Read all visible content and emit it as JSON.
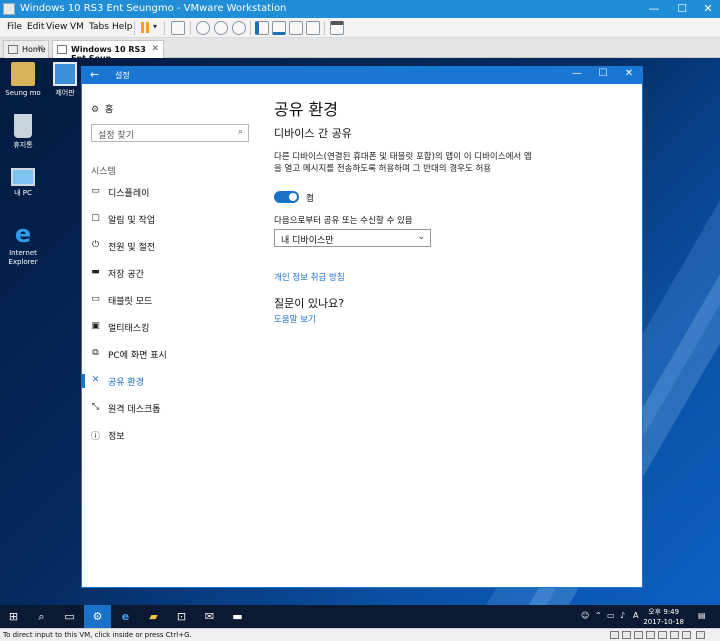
{
  "vmware": {
    "title": "Windows 10 RS3 Ent Seungmo - VMware Workstation",
    "menu": [
      "File",
      "Edit",
      "View",
      "VM",
      "Tabs",
      "Help"
    ],
    "tabs": [
      {
        "label": "Home",
        "active": false
      },
      {
        "label": "Windows 10 RS3 Ent Seun...",
        "active": true
      }
    ],
    "status_text": "To direct input to this VM, click inside or press Ctrl+G."
  },
  "desktop": {
    "icons": [
      {
        "label": "Seung mo",
        "icon": "user-folder-icon"
      },
      {
        "label": "제어판",
        "icon": "control-panel-icon"
      },
      {
        "label": "휴지통",
        "icon": "recycle-bin-icon"
      },
      {
        "label": "내 PC",
        "icon": "computer-icon"
      },
      {
        "label": "Internet Explorer",
        "icon": "ie-icon"
      }
    ]
  },
  "settings": {
    "window_title": "설정",
    "home_label": "홈",
    "search_placeholder": "설정 찾기",
    "section_label": "시스템",
    "nav": [
      {
        "label": "디스플레이",
        "icon": "display-icon",
        "active": false
      },
      {
        "label": "알림 및 작업",
        "icon": "notifications-icon",
        "active": false
      },
      {
        "label": "전원 및 절전",
        "icon": "power-icon",
        "active": false
      },
      {
        "label": "저장 공간",
        "icon": "storage-icon",
        "active": false
      },
      {
        "label": "태블릿 모드",
        "icon": "tablet-icon",
        "active": false
      },
      {
        "label": "멀티태스킹",
        "icon": "multitasking-icon",
        "active": false
      },
      {
        "label": "PC에 화면 표시",
        "icon": "project-icon",
        "active": false
      },
      {
        "label": "공유 환경",
        "icon": "shared-experiences-icon",
        "active": true
      },
      {
        "label": "원격 데스크톱",
        "icon": "remote-desktop-icon",
        "active": false
      },
      {
        "label": "정보",
        "icon": "info-icon",
        "active": false
      }
    ],
    "page_title": "공유 환경",
    "subheading": "디바이스 간 공유",
    "description": "다른 디바이스(연결된 휴대폰 및 태블릿 포함)의 앱이 이 디바이스에서 앱을 열고 메시지를 전송하도록 허용하며 그 반대의 경우도 허용",
    "toggle_state": "켬",
    "receive_label": "다음으로부터 공유 또는 수신할 수 있음",
    "receive_value": "내 디바이스만",
    "privacy_link": "개인 정보 취급 방침",
    "question_heading": "질문이 있나요?",
    "help_link": "도움말 보기"
  },
  "taskbar": {
    "time": "오후 9:49",
    "date": "2017-10-18",
    "accent": "#1a73c8"
  }
}
